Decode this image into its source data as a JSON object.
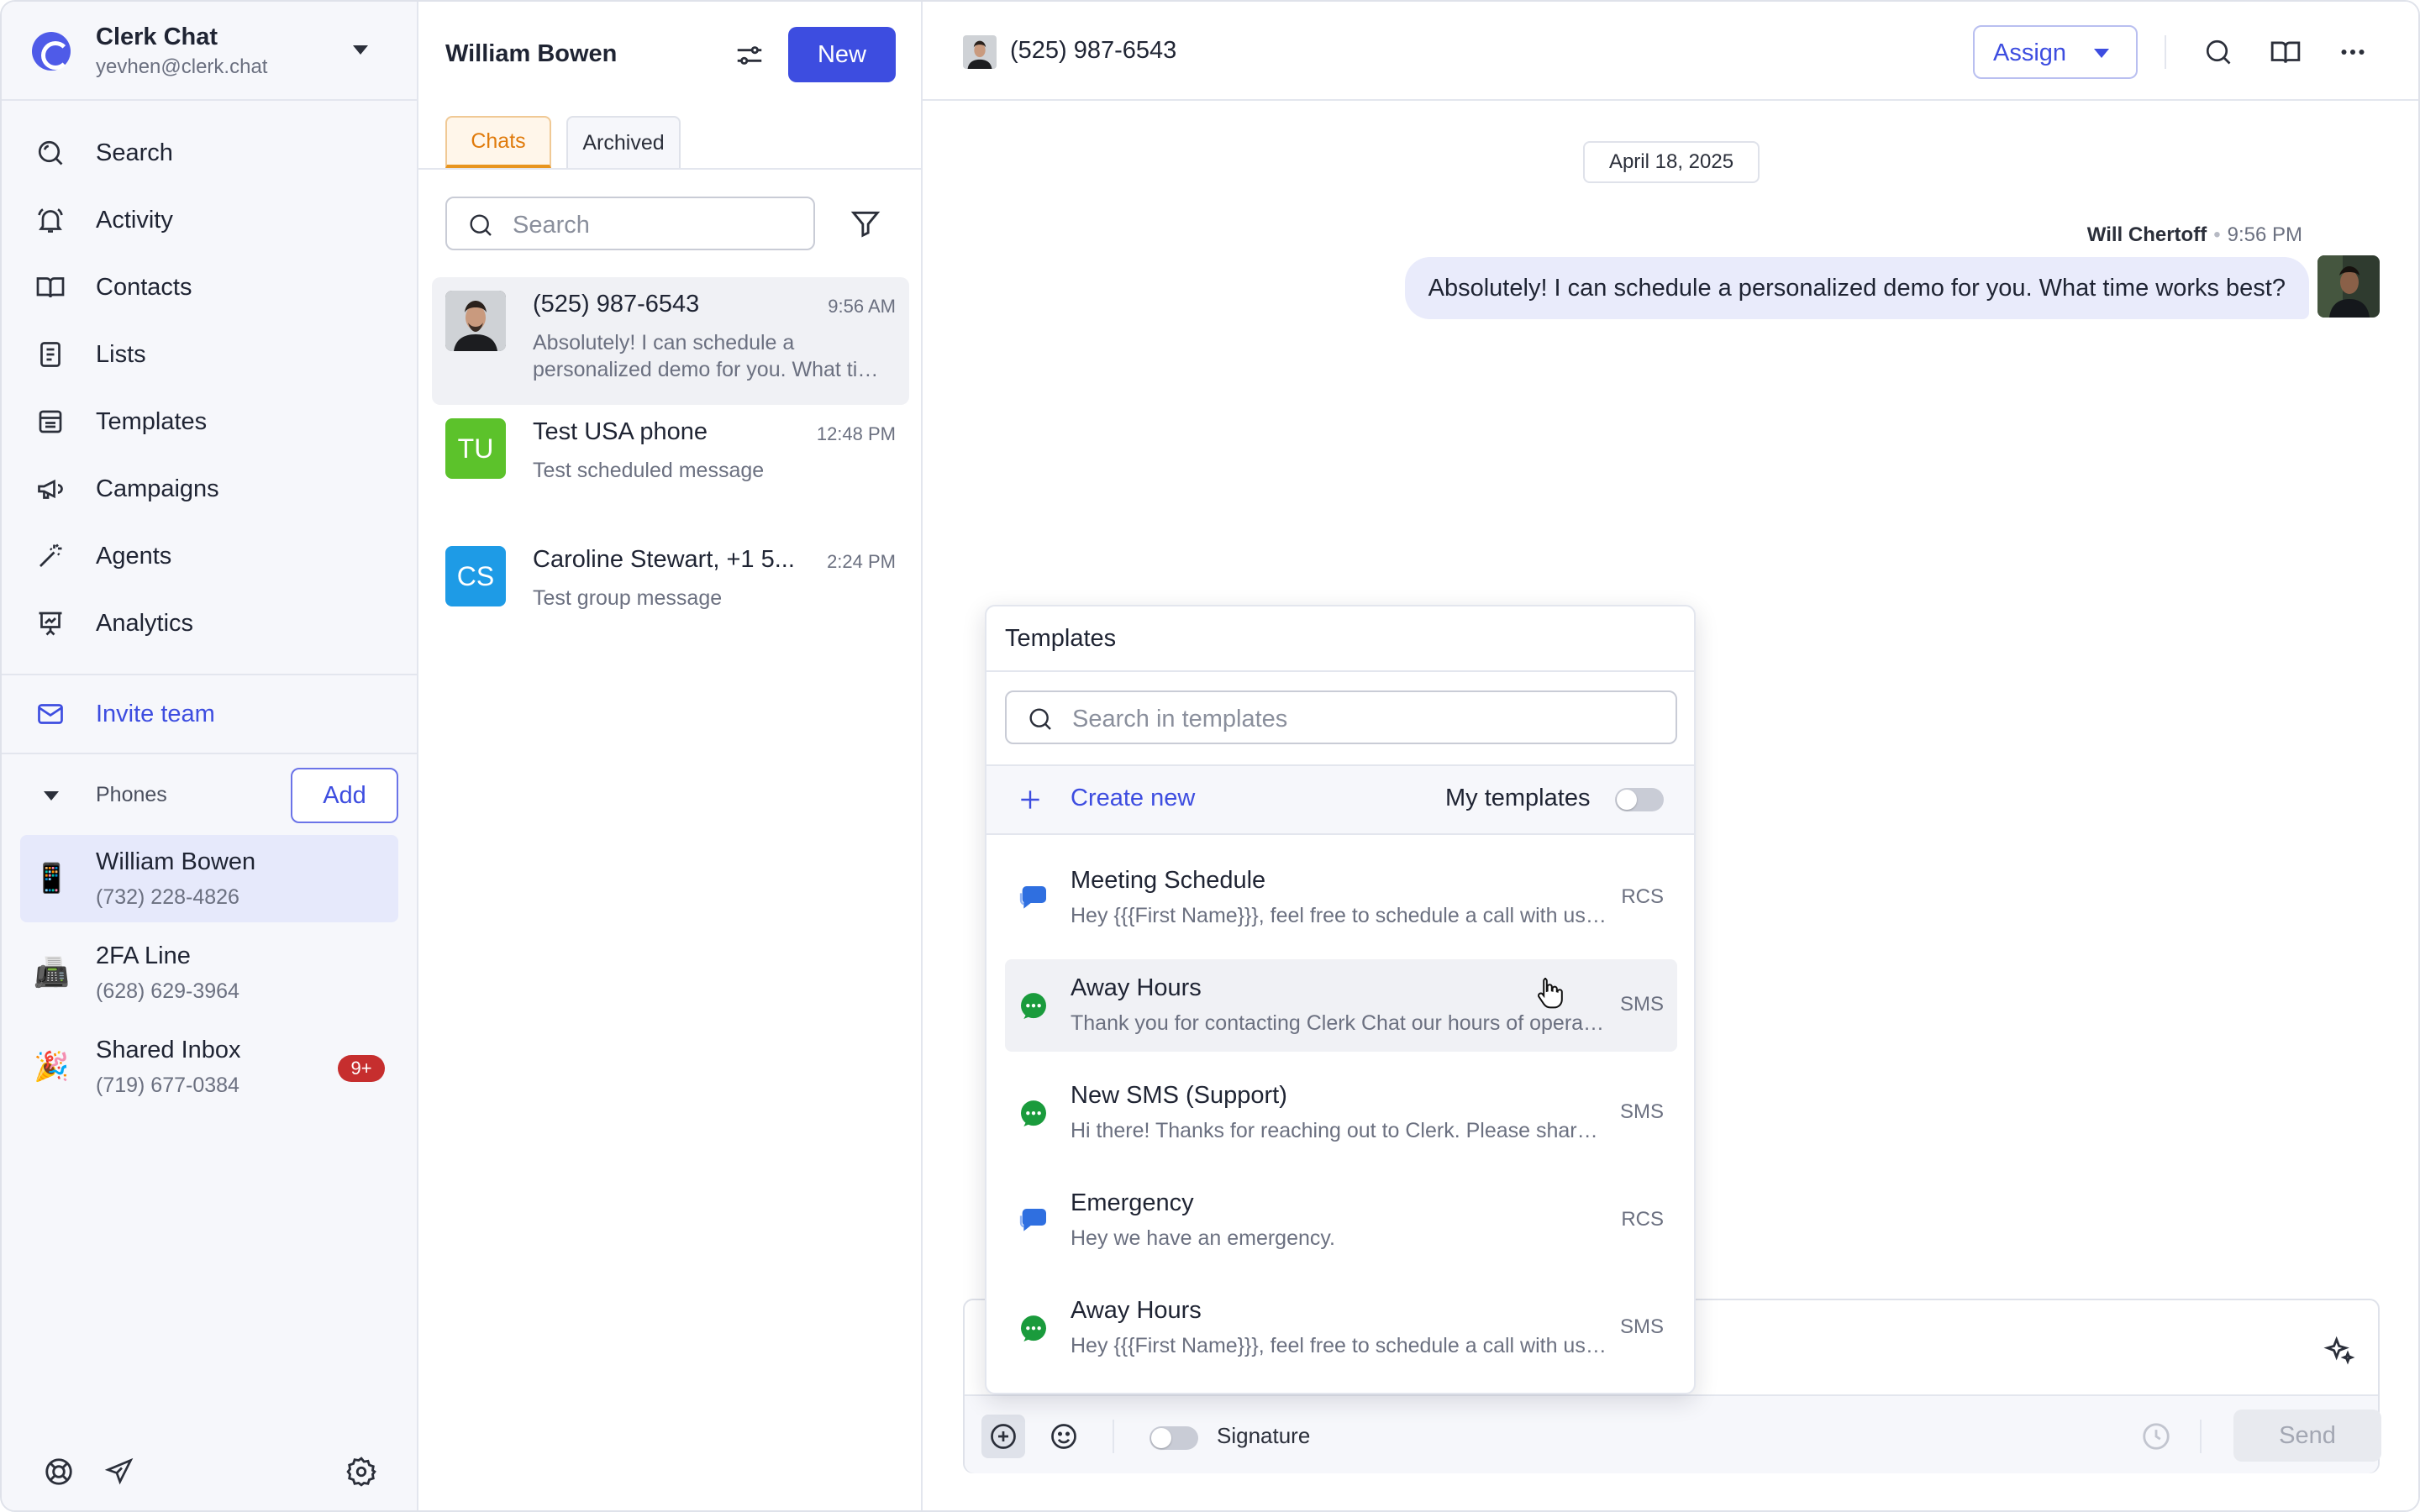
{
  "account": {
    "name": "Clerk Chat",
    "email": "yevhen@clerk.chat"
  },
  "nav": [
    {
      "label": "Search",
      "icon": "search-icon"
    },
    {
      "label": "Activity",
      "icon": "bell-icon"
    },
    {
      "label": "Contacts",
      "icon": "book-icon"
    },
    {
      "label": "Lists",
      "icon": "list-icon"
    },
    {
      "label": "Templates",
      "icon": "template-icon"
    },
    {
      "label": "Campaigns",
      "icon": "megaphone-icon"
    },
    {
      "label": "Agents",
      "icon": "magic-wand-icon"
    },
    {
      "label": "Analytics",
      "icon": "presentation-chart-icon"
    }
  ],
  "invite": {
    "label": "Invite team",
    "icon": "mail-icon"
  },
  "phones": {
    "label": "Phones",
    "add_label": "Add",
    "items": [
      {
        "name": "William Bowen",
        "number": "(732) 228-4826",
        "emoji": "📱",
        "active": true
      },
      {
        "name": "2FA Line",
        "number": "(628) 629-3964",
        "emoji": "📠"
      },
      {
        "name": "Shared Inbox",
        "number": "(719) 677-0384",
        "emoji": "🎉",
        "badge": "9+"
      }
    ]
  },
  "chat_list": {
    "title": "William Bowen",
    "new_label": "New",
    "tabs": [
      {
        "label": "Chats",
        "active": true
      },
      {
        "label": "Archived"
      }
    ],
    "search_placeholder": "Search",
    "conversations": [
      {
        "name": "(525) 987-6543",
        "time": "9:56 AM",
        "preview": "Absolutely! I can schedule a personalized demo for you. What time works best?",
        "avatar": "photo",
        "active": true
      },
      {
        "name": "Test USA phone",
        "time": "12:48 PM",
        "preview": "Test scheduled message",
        "initials": "TU",
        "color": "#5cc22b"
      },
      {
        "name": "Caroline Stewart, +1 5...",
        "time": "2:24 PM",
        "preview": "Test group message",
        "initials": "CS",
        "color": "#1e9be6"
      }
    ]
  },
  "conversation": {
    "title": "(525) 987-6543",
    "assign_label": "Assign",
    "date": "April 18, 2025",
    "message": {
      "sender": "Will Chertoff",
      "time": "9:56 PM",
      "text": "Absolutely! I can schedule a personalized demo for you. What time works best?"
    }
  },
  "composer": {
    "signature_label": "Signature",
    "send_label": "Send"
  },
  "templates": {
    "title": "Templates",
    "search_placeholder": "Search in templates",
    "create_label": "Create new",
    "my_templates_label": "My templates",
    "items": [
      {
        "name": "Meeting Schedule",
        "body": "Hey {{{First Name}}}, feel free to schedule a call with us at your convenience",
        "kind": "RCS"
      },
      {
        "name": "Away Hours",
        "body": "Thank you for contacting Clerk Chat our hours of operation are Monday to Friday",
        "kind": "SMS",
        "hover": true
      },
      {
        "name": "New SMS (Support)",
        "body": "Hi there! Thanks for reaching out to Clerk. Please share more details",
        "kind": "SMS"
      },
      {
        "name": "Emergency",
        "body": "Hey we have an emergency.",
        "kind": "RCS"
      },
      {
        "name": "Away Hours",
        "body": "Hey {{{First Name}}}, feel free to schedule a call with us at your convenience",
        "kind": "SMS"
      }
    ]
  },
  "colors": {
    "accent": "#3d4de0",
    "sms": "#1a9b3c",
    "rcs": "#2f6fe0",
    "badge": "#c62e2e",
    "tab_active": "#e07b0c"
  }
}
